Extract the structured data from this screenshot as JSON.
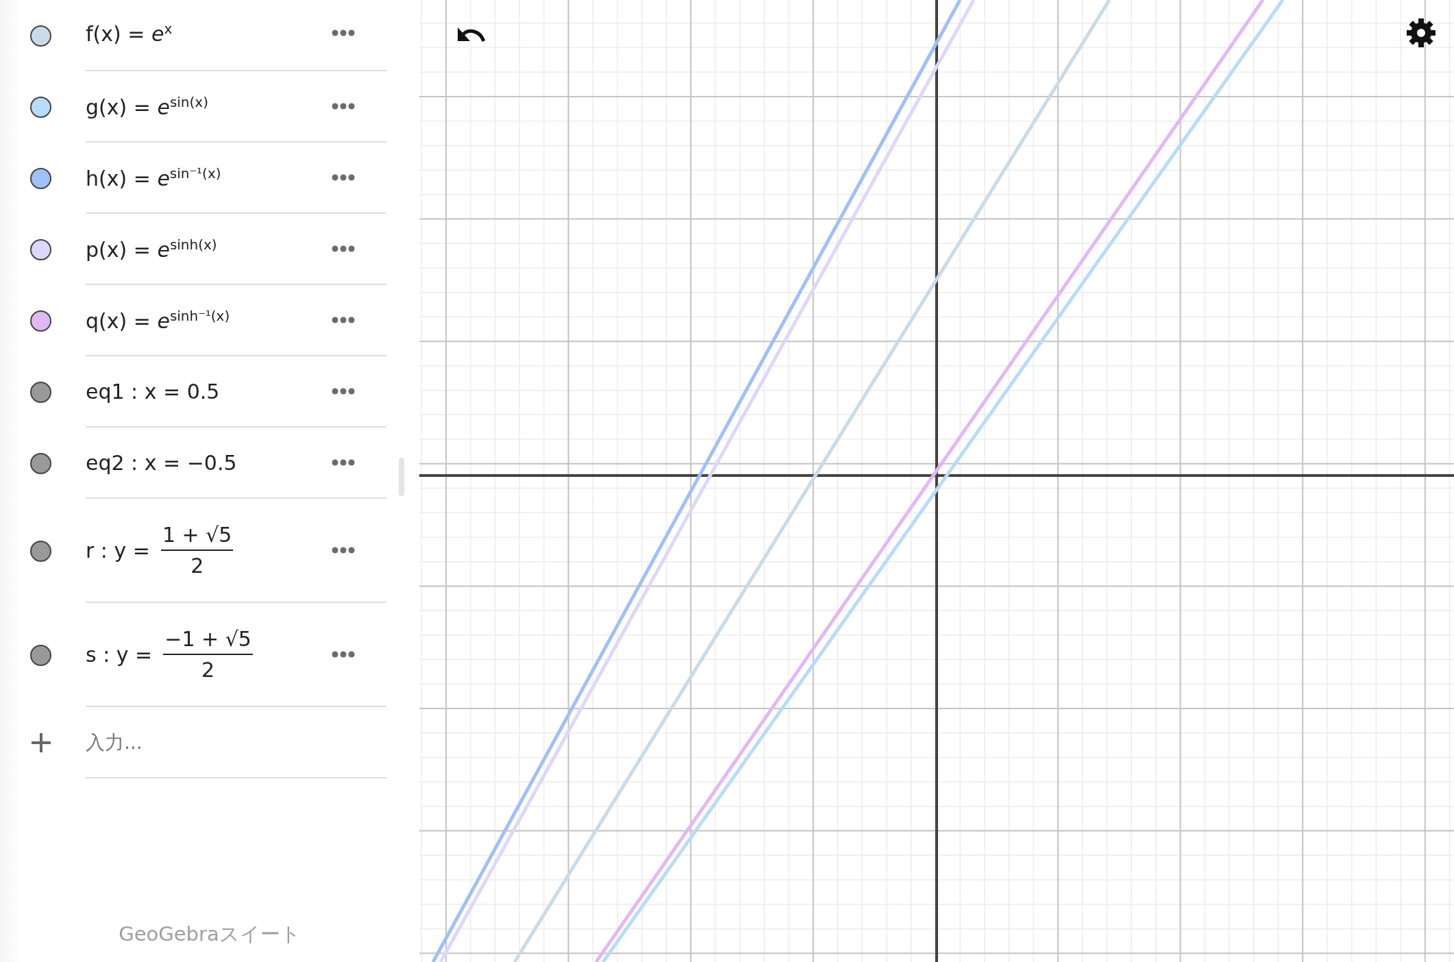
{
  "algebra_view": {
    "items": [
      {
        "kind": "expression",
        "text": "f(x) = *e*$^{x}$",
        "color": "#c9dbe8"
      },
      {
        "kind": "expression",
        "text": "g(x) = *e*$^{sin(x)}$",
        "color": "#b8dcf8"
      },
      {
        "kind": "expression",
        "text": "h(x) = *e*$^{sin⁻¹(x)}$",
        "color": "#9fc0f8"
      },
      {
        "kind": "expression",
        "text": "p(x) = *e*$^{sinh(x)}$",
        "color": "#ddd8fa"
      },
      {
        "kind": "expression",
        "text": "q(x) = *e*$^{sinh⁻¹(x)}$",
        "color": "#e2b8f4"
      },
      {
        "kind": "expression",
        "text": "eq1 : x = 0.5",
        "color": "#999999"
      },
      {
        "kind": "expression",
        "text": "eq2 : x = −0.5",
        "color": "#999999"
      },
      {
        "kind": "fraction",
        "lhs": "r : y =",
        "numerator": "1 + √5",
        "denominator": "2",
        "color": "#999999"
      },
      {
        "kind": "fraction",
        "lhs": "s : y =",
        "numerator": "−1 + √5",
        "denominator": "2",
        "color": "#999999"
      }
    ],
    "input": {
      "placeholder": "入力..."
    },
    "footer": "GeoGebraスイート"
  }
}
